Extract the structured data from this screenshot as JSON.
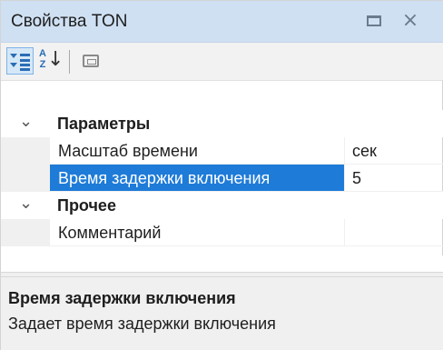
{
  "window": {
    "title": "Свойства TON",
    "maximize_icon": "window-maximize-icon",
    "close_glyph": "×"
  },
  "toolbar": {
    "categorized_icon": "categorized-sort-icon",
    "alphabetical_icon": "alphabetical-sort-icon",
    "alpha_letters": "A Z",
    "alpha_arrow": "↓",
    "property_pages_icon": "property-pages-icon"
  },
  "grid": {
    "categories": [
      {
        "label": "Параметры",
        "expanded": true,
        "chevron": "⌄",
        "properties": [
          {
            "name": "Масштаб времени",
            "value": "сек",
            "selected": false
          },
          {
            "name": "Время задержки включения",
            "value": "5",
            "selected": true
          }
        ]
      },
      {
        "label": "Прочее",
        "expanded": true,
        "chevron": "⌄",
        "properties": [
          {
            "name": "Комментарий",
            "value": "",
            "selected": false
          }
        ]
      }
    ]
  },
  "description": {
    "title": "Время задержки включения",
    "text": "Задает время задержки включения"
  },
  "colors": {
    "titlebar": "#cfe0f3",
    "selection": "#1e7bd8",
    "gutter": "#f0f0f0",
    "accent_icon": "#2a6db5"
  }
}
